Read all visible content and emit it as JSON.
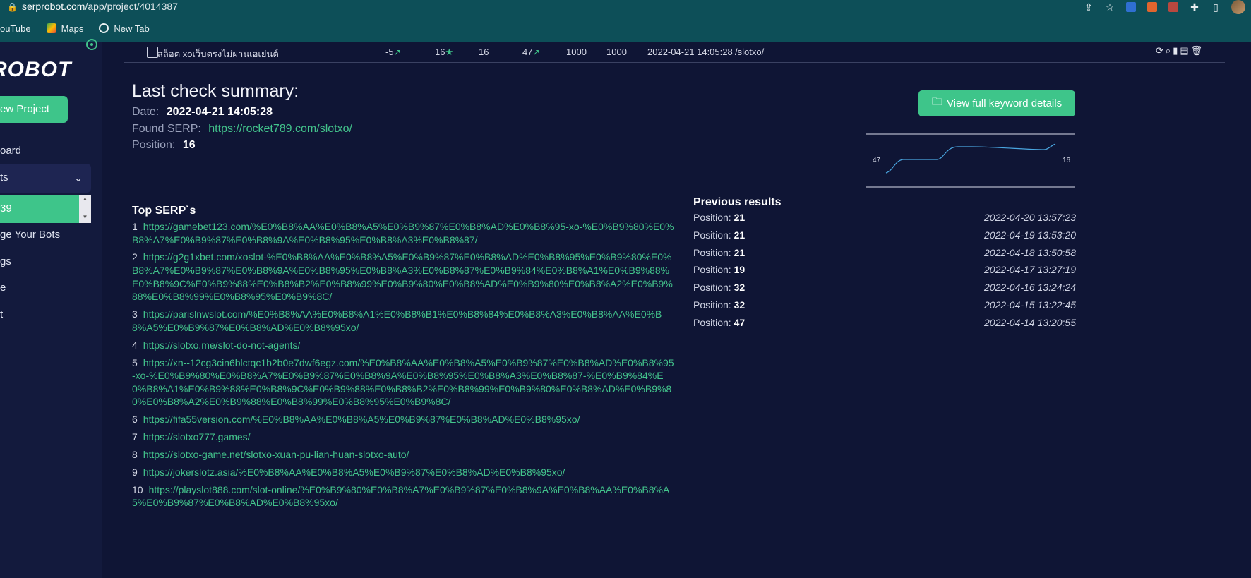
{
  "browser": {
    "url_host": "serprobot.com",
    "url_path": "/app/project/4014387",
    "bookmarks": [
      {
        "label": "ouTube"
      },
      {
        "label": "Maps"
      },
      {
        "label": "New Tab"
      }
    ]
  },
  "sidebar": {
    "brand": "ROBOT",
    "new_project": "ew Project",
    "items": [
      {
        "label": "oard"
      },
      {
        "label": "ts"
      },
      {
        "label": "39"
      },
      {
        "label": "ge Your Bots"
      },
      {
        "label": "gs"
      },
      {
        "label": "e"
      },
      {
        "label": "t"
      }
    ]
  },
  "keyword_row": {
    "keyword": "สล็อต xoเว็บตรงไม่ผ่านเอเย่นต์",
    "change": "-5",
    "position": "16",
    "best": "16",
    "first": "47",
    "volume_a": "1000",
    "volume_b": "1000",
    "date": "2022-04-21 14:05:28",
    "url": "/slotxo/"
  },
  "summary": {
    "title": "Last check summary:",
    "date_label": "Date:",
    "date_value": "2022-04-21 14:05:28",
    "found_label": "Found SERP:",
    "found_value": "https://rocket789.com/slotxo/",
    "position_label": "Position:",
    "position_value": "16",
    "view_button": "View full keyword details",
    "spark_start": "47",
    "spark_end": "16"
  },
  "top_serps": {
    "title": "Top SERP`s",
    "items": [
      {
        "n": "1",
        "url": "https://gamebet123.com/%E0%B8%AA%E0%B8%A5%E0%B9%87%E0%B8%AD%E0%B8%95-xo-%E0%B9%80%E0%B8%A7%E0%B9%87%E0%B8%9A%E0%B8%95%E0%B8%A3%E0%B8%87/"
      },
      {
        "n": "2",
        "url": "https://g2g1xbet.com/xoslot-%E0%B8%AA%E0%B8%A5%E0%B9%87%E0%B8%AD%E0%B8%95%E0%B9%80%E0%B8%A7%E0%B9%87%E0%B8%9A%E0%B8%95%E0%B8%A3%E0%B8%87%E0%B9%84%E0%B8%A1%E0%B9%88%E0%B8%9C%E0%B9%88%E0%B8%B2%E0%B8%99%E0%B9%80%E0%B8%AD%E0%B9%80%E0%B8%A2%E0%B9%88%E0%B8%99%E0%B8%95%E0%B9%8C/"
      },
      {
        "n": "3",
        "url": "https://parislnwslot.com/%E0%B8%AA%E0%B8%A1%E0%B8%B1%E0%B8%84%E0%B8%A3%E0%B8%AA%E0%B8%A5%E0%B9%87%E0%B8%AD%E0%B8%95xo/"
      },
      {
        "n": "4",
        "url": "https://slotxo.me/slot-do-not-agents/"
      },
      {
        "n": "5",
        "url": "https://xn--12cg3cin6blctqc1b2b0e7dwf6egz.com/%E0%B8%AA%E0%B8%A5%E0%B9%87%E0%B8%AD%E0%B8%95-xo-%E0%B9%80%E0%B8%A7%E0%B9%87%E0%B8%9A%E0%B8%95%E0%B8%A3%E0%B8%87-%E0%B9%84%E0%B8%A1%E0%B9%88%E0%B8%9C%E0%B9%88%E0%B8%B2%E0%B8%99%E0%B9%80%E0%B8%AD%E0%B9%80%E0%B8%A2%E0%B9%88%E0%B8%99%E0%B8%95%E0%B9%8C/"
      },
      {
        "n": "6",
        "url": "https://fifa55version.com/%E0%B8%AA%E0%B8%A5%E0%B9%87%E0%B8%AD%E0%B8%95xo/"
      },
      {
        "n": "7",
        "url": "https://slotxo777.games/"
      },
      {
        "n": "8",
        "url": "https://slotxo-game.net/slotxo-xuan-pu-lian-huan-slotxo-auto/"
      },
      {
        "n": "9",
        "url": "https://jokerslotz.asia/%E0%B8%AA%E0%B8%A5%E0%B9%87%E0%B8%AD%E0%B8%95xo/"
      },
      {
        "n": "10",
        "url": "https://playslot888.com/slot-online/%E0%B9%80%E0%B8%A7%E0%B9%87%E0%B8%9A%E0%B8%AA%E0%B8%A5%E0%B9%87%E0%B8%AD%E0%B8%95xo/"
      }
    ]
  },
  "previous": {
    "title": "Previous results",
    "label": "Position:",
    "items": [
      {
        "position": "21",
        "date": "2022-04-20 13:57:23"
      },
      {
        "position": "21",
        "date": "2022-04-19 13:53:20"
      },
      {
        "position": "21",
        "date": "2022-04-18 13:50:58"
      },
      {
        "position": "19",
        "date": "2022-04-17 13:27:19"
      },
      {
        "position": "32",
        "date": "2022-04-16 13:24:24"
      },
      {
        "position": "32",
        "date": "2022-04-15 13:22:45"
      },
      {
        "position": "47",
        "date": "2022-04-14 13:20:55"
      }
    ]
  },
  "colors": {
    "accent": "#3ec58a",
    "background": "#0f1535",
    "chrome": "#0d4f58"
  }
}
